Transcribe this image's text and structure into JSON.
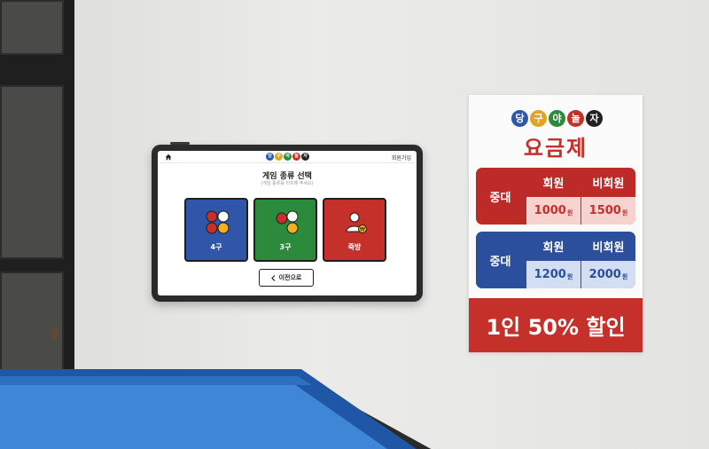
{
  "tablet": {
    "header": {
      "logo": [
        {
          "char": "당",
          "color": "#2f56a8"
        },
        {
          "char": "구",
          "color": "#e0a522"
        },
        {
          "char": "야",
          "color": "#2c8a3c"
        },
        {
          "char": "놀",
          "color": "#c6302b"
        },
        {
          "char": "자",
          "color": "#222222"
        }
      ],
      "join_label": "회원가입"
    },
    "title": "게임 종류 선택",
    "subtitle": "(게임 종류를 터치해 주세요)",
    "options": [
      {
        "label": "4구",
        "color": "#2f56a8"
      },
      {
        "label": "3구",
        "color": "#2c8a3c"
      },
      {
        "label": "죽방",
        "color": "#c6302b"
      }
    ],
    "prev_button": "이전으로"
  },
  "poster": {
    "logo": [
      {
        "char": "당",
        "color": "#2f56a8"
      },
      {
        "char": "구",
        "color": "#e0a522"
      },
      {
        "char": "야",
        "color": "#2c8a3c"
      },
      {
        "char": "놀",
        "color": "#c6302b"
      },
      {
        "char": "자",
        "color": "#222222"
      }
    ],
    "title": "요금제",
    "tables": [
      {
        "size": "중대",
        "member_label": "회원",
        "nonmember_label": "비회원",
        "member_price": "1000",
        "nonmember_price": "1500",
        "unit": "원"
      },
      {
        "size": "중대",
        "member_label": "회원",
        "nonmember_label": "비회원",
        "member_price": "1200",
        "nonmember_price": "2000",
        "unit": "원"
      }
    ],
    "discount": "1인 50% 할인"
  }
}
